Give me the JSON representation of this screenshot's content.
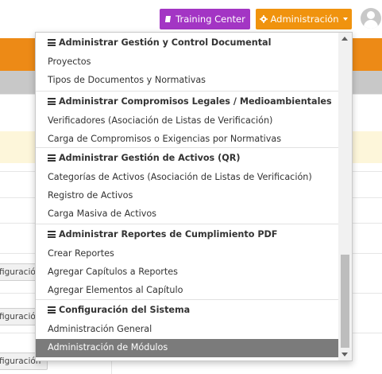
{
  "header": {
    "training_label": "Training Center",
    "admin_label": "Administración",
    "icons": {
      "training": "book-icon",
      "admin": "gear-icon",
      "avatar": "user-avatar-icon"
    },
    "colors": {
      "training": "#a335c4",
      "admin": "#f0930e",
      "band": "#ed8a16"
    }
  },
  "background": {
    "buttons": [
      "figuración",
      "figuración",
      "figuración"
    ]
  },
  "menu": {
    "sections": [
      {
        "header": "Administrar Gestión y Control Documental",
        "items": [
          "Proyectos",
          "Tipos de Documentos y Normativas"
        ]
      },
      {
        "header": "Administrar Compromisos Legales / Medioambientales",
        "items": [
          "Verificadores (Asociación de Listas de Verificación)",
          "Carga de Compromisos o Exigencias por Normativas"
        ]
      },
      {
        "header": "Administrar Gestión de Activos (QR)",
        "items": [
          "Categorías de Activos (Asociación de Listas de Verificación)",
          "Registro de Activos",
          "Carga Masiva de Activos"
        ]
      },
      {
        "header": "Administrar Reportes de Cumplimiento PDF",
        "items": [
          "Crear Reportes",
          "Agregar Capítulos a Reportes",
          "Agregar Elementos al Capítulo"
        ]
      },
      {
        "header": "Configuración del Sistema",
        "items": [
          "Administración General",
          "Administración de Módulos"
        ]
      }
    ],
    "highlighted_item": "Administración de Módulos"
  }
}
